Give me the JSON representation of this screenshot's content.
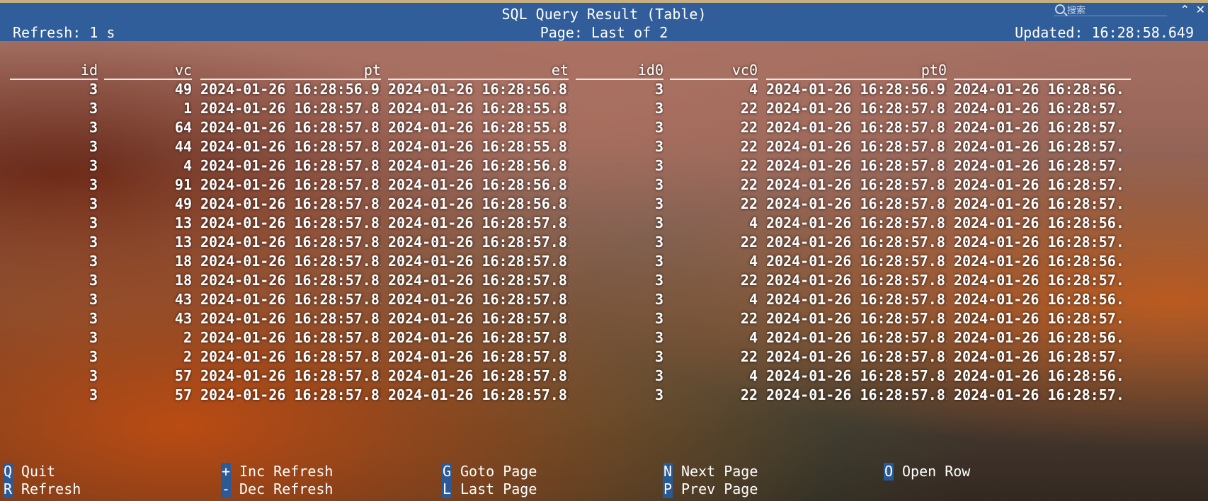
{
  "window": {
    "title": "SQL Query Result (Table)",
    "search_placeholder": "搜索",
    "collapse_label": "⌃",
    "close_label": "✕"
  },
  "status": {
    "refresh": "Refresh: 1 s",
    "page": "Page: Last of 2",
    "updated": "Updated: 16:28:58.649"
  },
  "table": {
    "headers": [
      "id",
      "vc",
      "pt",
      "et",
      "id0",
      "vc0",
      "pt0",
      ""
    ],
    "rows": [
      [
        "3",
        "49",
        "2024-01-26 16:28:56.912",
        "2024-01-26 16:28:56.813",
        "3",
        "4",
        "2024-01-26 16:28:56.912",
        "2024-01-26 16:28:56."
      ],
      [
        "3",
        "1",
        "2024-01-26 16:28:57.811",
        "2024-01-26 16:28:55.813",
        "3",
        "22",
        "2024-01-26 16:28:57.811",
        "2024-01-26 16:28:57."
      ],
      [
        "3",
        "64",
        "2024-01-26 16:28:57.811",
        "2024-01-26 16:28:55.812",
        "3",
        "22",
        "2024-01-26 16:28:57.811",
        "2024-01-26 16:28:57."
      ],
      [
        "3",
        "44",
        "2024-01-26 16:28:57.811",
        "2024-01-26 16:28:55.812",
        "3",
        "22",
        "2024-01-26 16:28:57.811",
        "2024-01-26 16:28:57."
      ],
      [
        "3",
        "4",
        "2024-01-26 16:28:57.811",
        "2024-01-26 16:28:56.813",
        "3",
        "22",
        "2024-01-26 16:28:57.811",
        "2024-01-26 16:28:57."
      ],
      [
        "3",
        "91",
        "2024-01-26 16:28:57.811",
        "2024-01-26 16:28:56.813",
        "3",
        "22",
        "2024-01-26 16:28:57.811",
        "2024-01-26 16:28:57."
      ],
      [
        "3",
        "49",
        "2024-01-26 16:28:57.811",
        "2024-01-26 16:28:56.813",
        "3",
        "22",
        "2024-01-26 16:28:57.811",
        "2024-01-26 16:28:57."
      ],
      [
        "3",
        "13",
        "2024-01-26 16:28:57.814",
        "2024-01-26 16:28:57.812",
        "3",
        "4",
        "2024-01-26 16:28:57.814",
        "2024-01-26 16:28:56."
      ],
      [
        "3",
        "13",
        "2024-01-26 16:28:57.814",
        "2024-01-26 16:28:57.812",
        "3",
        "22",
        "2024-01-26 16:28:57.814",
        "2024-01-26 16:28:57."
      ],
      [
        "3",
        "18",
        "2024-01-26 16:28:57.814",
        "2024-01-26 16:28:57.813",
        "3",
        "4",
        "2024-01-26 16:28:57.814",
        "2024-01-26 16:28:56."
      ],
      [
        "3",
        "18",
        "2024-01-26 16:28:57.814",
        "2024-01-26 16:28:57.813",
        "3",
        "22",
        "2024-01-26 16:28:57.814",
        "2024-01-26 16:28:57."
      ],
      [
        "3",
        "43",
        "2024-01-26 16:28:57.814",
        "2024-01-26 16:28:57.813",
        "3",
        "4",
        "2024-01-26 16:28:57.814",
        "2024-01-26 16:28:56."
      ],
      [
        "3",
        "43",
        "2024-01-26 16:28:57.814",
        "2024-01-26 16:28:57.813",
        "3",
        "22",
        "2024-01-26 16:28:57.814",
        "2024-01-26 16:28:57."
      ],
      [
        "3",
        "2",
        "2024-01-26 16:28:57.814",
        "2024-01-26 16:28:57.813",
        "3",
        "4",
        "2024-01-26 16:28:57.814",
        "2024-01-26 16:28:56."
      ],
      [
        "3",
        "2",
        "2024-01-26 16:28:57.814",
        "2024-01-26 16:28:57.813",
        "3",
        "22",
        "2024-01-26 16:28:57.814",
        "2024-01-26 16:28:57."
      ],
      [
        "3",
        "57",
        "2024-01-26 16:28:57.815",
        "2024-01-26 16:28:57.813",
        "3",
        "4",
        "2024-01-26 16:28:57.815",
        "2024-01-26 16:28:56."
      ],
      [
        "3",
        "57",
        "2024-01-26 16:28:57.815",
        "2024-01-26 16:28:57.813",
        "3",
        "22",
        "2024-01-26 16:28:57.815",
        "2024-01-26 16:28:57."
      ]
    ]
  },
  "footer": {
    "row1": [
      {
        "key": "Q",
        "label": "Quit"
      },
      {
        "key": "+",
        "label": "Inc Refresh"
      },
      {
        "key": "G",
        "label": "Goto Page"
      },
      {
        "key": "N",
        "label": "Next Page"
      },
      {
        "key": "O",
        "label": "Open Row"
      }
    ],
    "row2": [
      {
        "key": "R",
        "label": "Refresh"
      },
      {
        "key": "-",
        "label": "Dec Refresh"
      },
      {
        "key": "L",
        "label": "Last Page"
      },
      {
        "key": "P",
        "label": "Prev Page"
      }
    ]
  }
}
